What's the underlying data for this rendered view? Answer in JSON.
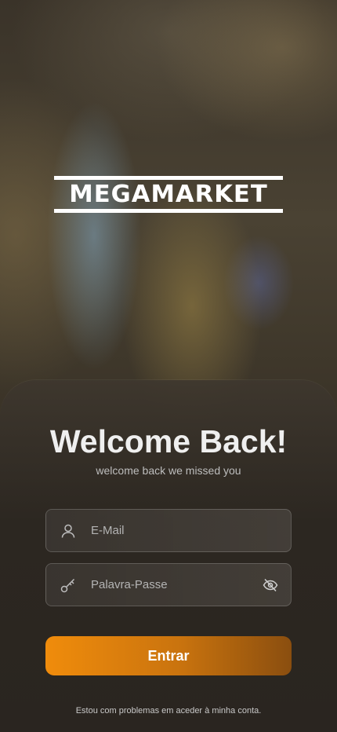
{
  "brand": {
    "logo_text": "MEGAMARKET"
  },
  "header": {
    "title": "Welcome Back!",
    "subtitle": "welcome back we missed you"
  },
  "form": {
    "email": {
      "placeholder": "E-Mail",
      "icon": "user-icon"
    },
    "password": {
      "placeholder": "Palavra-Passe",
      "icon": "key-icon",
      "toggle_icon": "eye-off-icon"
    },
    "submit_label": "Entrar",
    "help_link": "Estou com problemas em aceder à minha conta."
  },
  "colors": {
    "accent_start": "#f08c0c",
    "accent_end": "#8a4e0f",
    "card_bg": "#2a2520"
  }
}
